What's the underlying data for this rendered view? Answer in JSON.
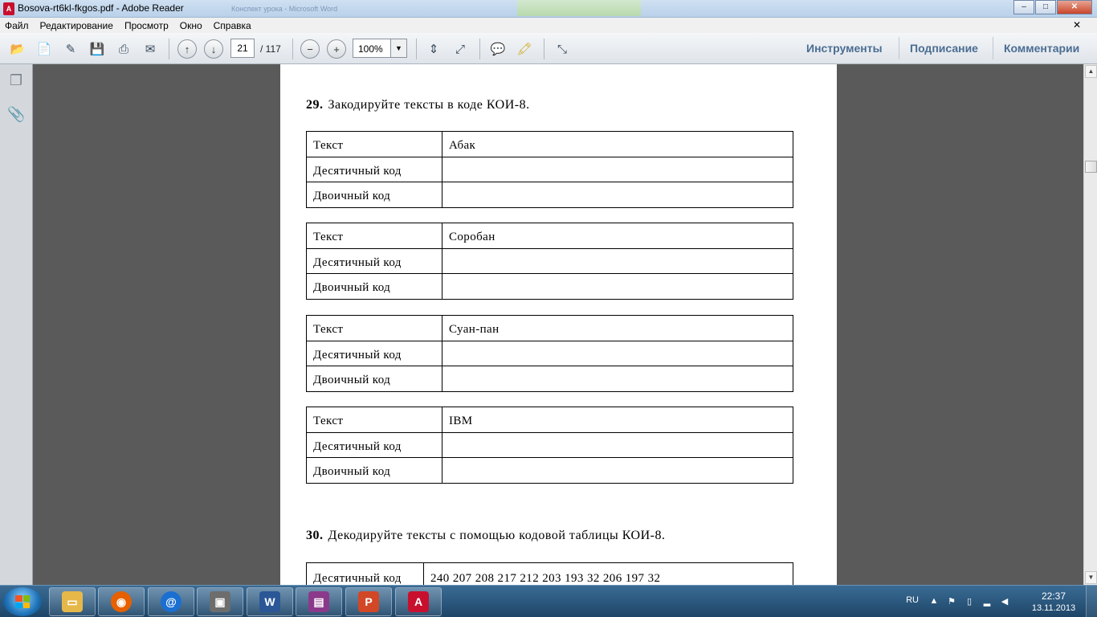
{
  "window": {
    "title": "Bosova-rt6kl-fkgos.pdf - Adobe Reader",
    "background_title": "Конспект урока - Microsoft Word",
    "minimize": "–",
    "maximize": "□",
    "close": "✕"
  },
  "menu": {
    "items": [
      "Файл",
      "Редактирование",
      "Просмотр",
      "Окно",
      "Справка"
    ],
    "close": "✕"
  },
  "toolbar": {
    "current_page": "21",
    "total_pages": "/ 117",
    "zoom": "100%",
    "tools_tab": "Инструменты",
    "sign_tab": "Подписание",
    "comments_tab": "Комментарии"
  },
  "document": {
    "q29_number": "29.",
    "q29_text": "Закодируйте тексты в коде КОИ-8.",
    "tables": [
      {
        "text_label": "Текст",
        "text_value": "Абак",
        "dec_label": "Десятичный код",
        "bin_label": "Двоичный код"
      },
      {
        "text_label": "Текст",
        "text_value": "Соробан",
        "dec_label": "Десятичный код",
        "bin_label": "Двоичный код"
      },
      {
        "text_label": "Текст",
        "text_value": "Суан-пан",
        "dec_label": "Десятичный код",
        "bin_label": "Двоичный код"
      },
      {
        "text_label": "Текст",
        "text_value": "IBM",
        "dec_label": "Десятичный код",
        "bin_label": "Двоичный код"
      }
    ],
    "q30_number": "30.",
    "q30_text": "Декодируйте тексты с помощью кодовой таблицы КОИ-8.",
    "decode_label": "Десятичный код",
    "decode_values": "240 207 208 217 212 203 193 32 206 197 32"
  },
  "taskbar": {
    "language": "RU",
    "time": "22:37",
    "date": "13.11.2013"
  },
  "colors": {
    "toolbar_tab": "#4b6d92",
    "taskbar": "#1e4567",
    "doc_background": "#5a5a5a"
  }
}
